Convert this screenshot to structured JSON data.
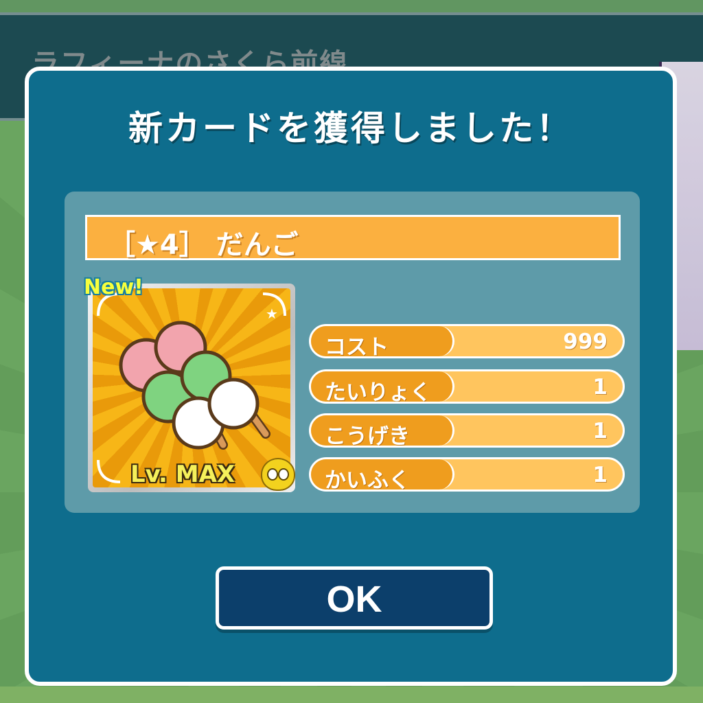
{
  "background": {
    "header_title": "ラフィーナのさくら前線"
  },
  "dialog": {
    "title": "新カードを獲得しました！",
    "card": {
      "name": "［★4］ だんご",
      "badge": "New!",
      "level": "Lv. MAX"
    },
    "stats": [
      {
        "label": "コスト",
        "value": "999"
      },
      {
        "label": "たいりょく",
        "value": "1"
      },
      {
        "label": "こうげき",
        "value": "1"
      },
      {
        "label": "かいふく",
        "value": "1"
      }
    ],
    "ok_label": "OK"
  },
  "colors": {
    "dialog_bg": "#0e6d8d",
    "panel_bg": "#5e9ba9",
    "name_bar": "#fbb040",
    "stat_label": "#ef9d1e",
    "stat_bar": "#ffc55e",
    "ok_button": "#0c3f6b"
  }
}
